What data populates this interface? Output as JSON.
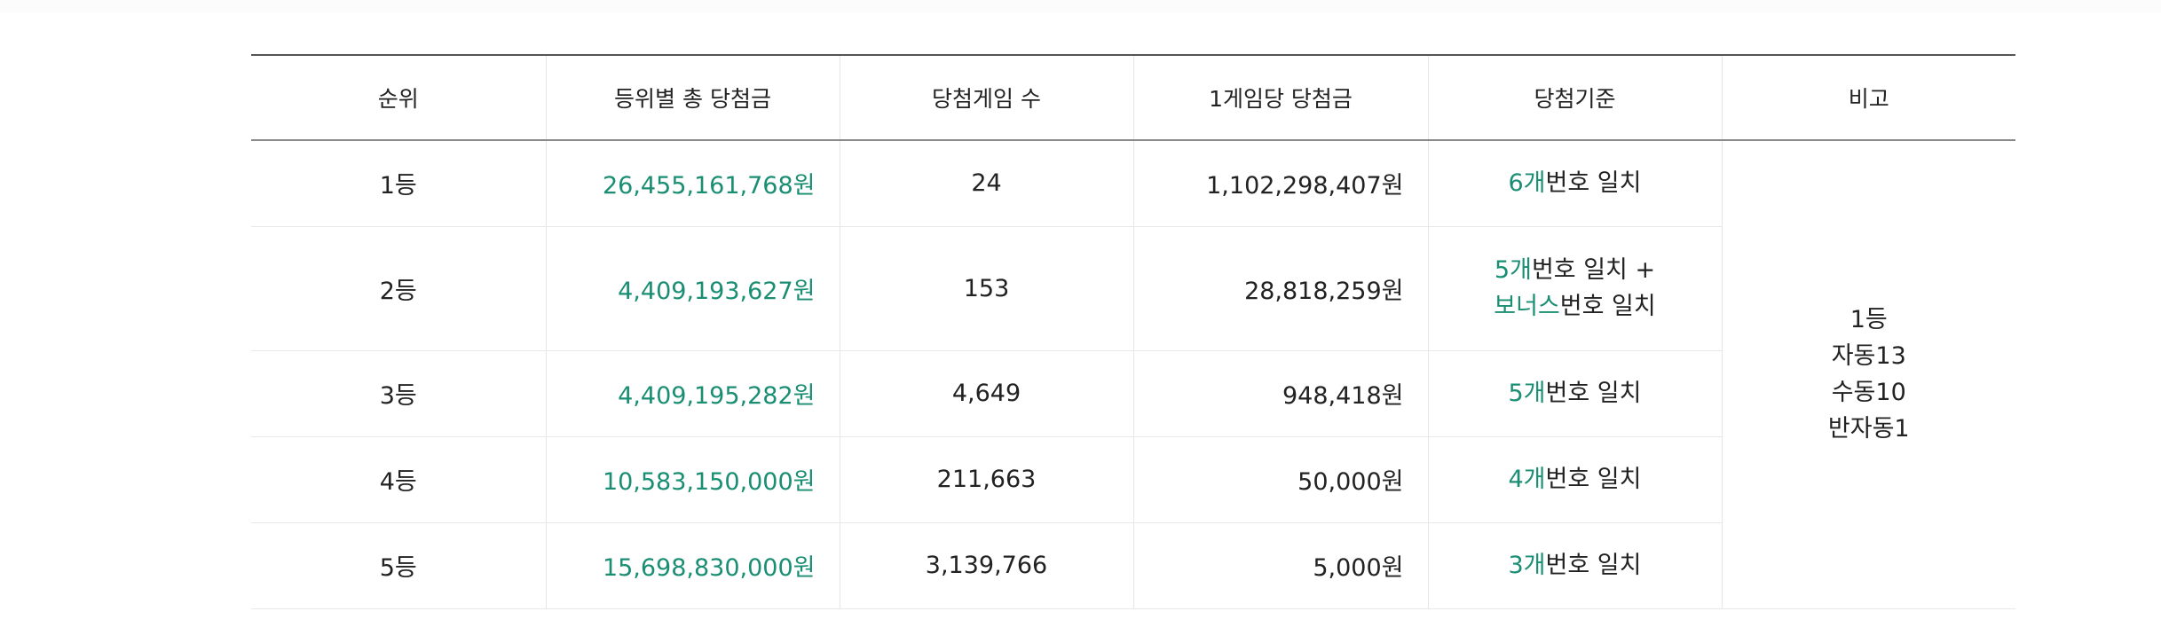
{
  "table": {
    "headers": [
      "순위",
      "등위별 총 당첨금",
      "당첨게임 수",
      "1게임당 당첨금",
      "당첨기준",
      "비고"
    ],
    "rows": [
      {
        "rank": "1등",
        "total_prize": "26,455,161,768원",
        "winner_count": "24",
        "prize_per_game": "1,102,298,407원",
        "criteria": [
          {
            "highlight": "6개",
            "text": "번호 일치"
          }
        ]
      },
      {
        "rank": "2등",
        "total_prize": "4,409,193,627원",
        "winner_count": "153",
        "prize_per_game": "28,818,259원",
        "criteria": [
          {
            "highlight": "5개",
            "text": "번호 일치 +"
          },
          {
            "highlight": "보너스",
            "text": "번호 일치"
          }
        ]
      },
      {
        "rank": "3등",
        "total_prize": "4,409,195,282원",
        "winner_count": "4,649",
        "prize_per_game": "948,418원",
        "criteria": [
          {
            "highlight": "5개",
            "text": "번호 일치"
          }
        ]
      },
      {
        "rank": "4등",
        "total_prize": "10,583,150,000원",
        "winner_count": "211,663",
        "prize_per_game": "50,000원",
        "criteria": [
          {
            "highlight": "4개",
            "text": "번호 일치"
          }
        ]
      },
      {
        "rank": "5등",
        "total_prize": "15,698,830,000원",
        "winner_count": "3,139,766",
        "prize_per_game": "5,000원",
        "criteria": [
          {
            "highlight": "3개",
            "text": "번호 일치"
          }
        ]
      }
    ],
    "note": [
      "1등",
      "자동13",
      "수동10",
      "반자동1"
    ]
  },
  "colors": {
    "accent": "#1a8e73",
    "text": "#222222",
    "header_top_border": "#555555",
    "cell_border": "#e6e6e6"
  }
}
